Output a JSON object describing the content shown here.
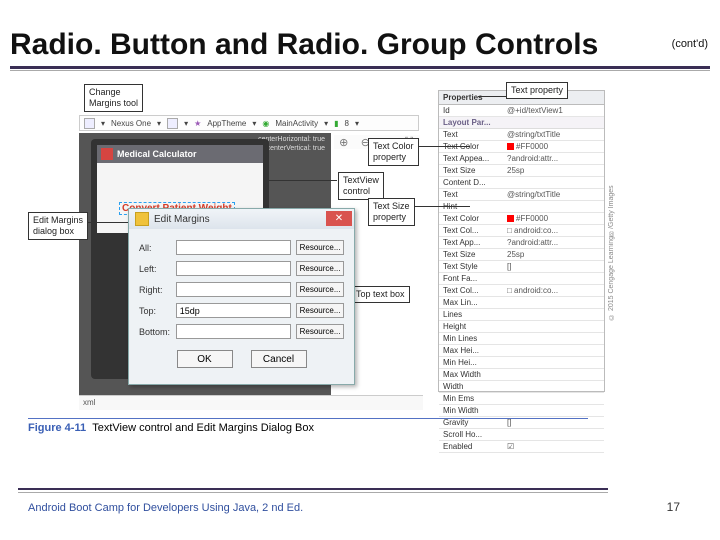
{
  "title": "Radio. Button and Radio. Group Controls",
  "contd": "(cont'd)",
  "toolbar": {
    "device": "Nexus One",
    "theme": "AppTheme",
    "activity": "MainActivity",
    "api": "8"
  },
  "zoom": {
    "in": "⊕",
    "out": "⊖",
    "fit": "▣",
    "full": "⛶"
  },
  "canvas": {
    "app_title": "Medical Calculator",
    "convert_label": "Convert Patient Weight",
    "hint1": "centerHorizontal: true",
    "hint2": "centerVertical: true"
  },
  "callouts": {
    "change_margins": "Change\nMargins tool",
    "edit_margins_box": "Edit Margins\ndialog box",
    "textview_control": "TextView\ncontrol",
    "top_text_box": "Top text box",
    "text_property": "Text property",
    "text_color_prop": "Text Color\nproperty",
    "text_size_prop": "Text Size\nproperty"
  },
  "dialog": {
    "title": "Edit Margins",
    "fields": {
      "all": "All:",
      "left": "Left:",
      "right": "Right:",
      "top": "Top:",
      "bottom": "Bottom:"
    },
    "top_value": "15dp",
    "resource_btn": "Resource...",
    "ok": "OK",
    "cancel": "Cancel"
  },
  "props": {
    "hdr_prop": "Properties",
    "id_k": "Id",
    "id_v": "@+id/textView1",
    "section": "Layout Par...",
    "rows": [
      [
        "Text",
        "@string/txtTitle"
      ],
      [
        "Text Color",
        "#FF0000"
      ],
      [
        "Text Appea...",
        "?android:attr..."
      ],
      [
        "Text Size",
        "25sp"
      ],
      [
        "Content D...",
        ""
      ],
      [
        "Text",
        "@string/txtTitle"
      ],
      [
        "Hint",
        ""
      ],
      [
        "Text Color",
        "#FF0000"
      ],
      [
        "Text Col...",
        "□ android:co..."
      ],
      [
        "Text App...",
        "?android:attr..."
      ],
      [
        "Text Size",
        "25sp"
      ],
      [
        "Text Style",
        "[]"
      ],
      [
        "Font Fa...",
        ""
      ],
      [
        "Text Col...",
        "□ android:co..."
      ],
      [
        "Max Lin...",
        ""
      ],
      [
        "Lines",
        ""
      ],
      [
        "Height",
        ""
      ],
      [
        "Min Lines",
        ""
      ],
      [
        "Max Hei...",
        ""
      ],
      [
        "Min Hei...",
        ""
      ],
      [
        "Max Width",
        ""
      ],
      [
        "Width",
        ""
      ],
      [
        "Min Ems",
        ""
      ],
      [
        "Min Width",
        ""
      ],
      [
        "Gravity",
        "[]"
      ],
      [
        "Scroll Ho...",
        ""
      ],
      [
        "Enabled",
        "☑"
      ]
    ]
  },
  "tabbar": "xml",
  "figure": {
    "num": "Figure 4-11",
    "cap": "TextView control and Edit Margins Dialog Box"
  },
  "copyright": "© 2015 Cengage Learning®/Getty Images",
  "footer": "Android Boot Camp for Developers Using Java, 2 nd Ed.",
  "page": "17"
}
